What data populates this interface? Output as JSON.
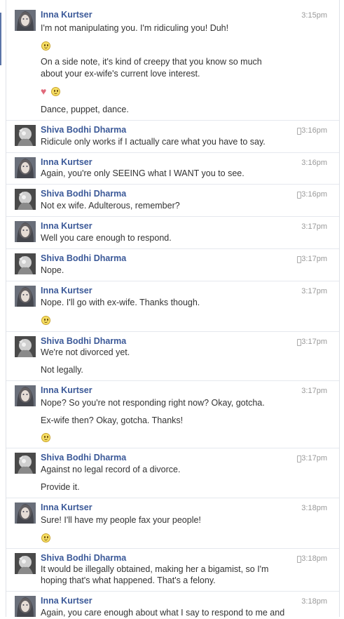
{
  "colors": {
    "sender_name": "#3b5998",
    "timestamp": "#999999",
    "message_text": "#333333",
    "divider": "#e5e8ee"
  },
  "icons": {
    "emoticon": "smiley-icon",
    "heart": "heart-icon",
    "mobile": "mobile-phone-icon"
  },
  "messages": [
    {
      "sender": "Inna Kurtser",
      "time": "3:15pm",
      "lines": [
        "I'm not manipulating you. I'm ridiculing you! Duh!",
        "On a side note, it's kind of creepy that you know so much",
        "about your ex-wife's current love interest.",
        "Dance, puppet, dance."
      ]
    },
    {
      "sender": "Shiva Bodhi Dharma",
      "time": "3:16pm",
      "lines": [
        "Ridicule only works if I actually care what you have to say."
      ]
    },
    {
      "sender": "Inna Kurtser",
      "time": "3:16pm",
      "lines": [
        "Again, you're only SEEING what I WANT you to see."
      ]
    },
    {
      "sender": "Shiva Bodhi Dharma",
      "time": "3:16pm",
      "lines": [
        "Not ex wife. Adulterous, remember?"
      ]
    },
    {
      "sender": "Inna Kurtser",
      "time": "3:17pm",
      "lines": [
        "Well you care enough to respond."
      ]
    },
    {
      "sender": "Shiva Bodhi Dharma",
      "time": "3:17pm",
      "lines": [
        "Nope."
      ]
    },
    {
      "sender": "Inna Kurtser",
      "time": "3:17pm",
      "lines": [
        "Nope. I'll go with ex-wife. Thanks though."
      ]
    },
    {
      "sender": "Shiva Bodhi Dharma",
      "time": "3:17pm",
      "lines": [
        "We're not divorced yet.",
        "Not legally."
      ]
    },
    {
      "sender": "Inna Kurtser",
      "time": "3:17pm",
      "lines": [
        "Nope? So you're not responding right now? Okay, gotcha.",
        "Ex-wife then? Okay, gotcha. Thanks!"
      ]
    },
    {
      "sender": "Shiva Bodhi Dharma",
      "time": "3:17pm",
      "lines": [
        "Against no legal record of a divorce.",
        "Provide it."
      ]
    },
    {
      "sender": "Inna Kurtser",
      "time": "3:18pm",
      "lines": [
        "Sure! I'll have my people fax your people!"
      ]
    },
    {
      "sender": "Shiva Bodhi Dharma",
      "time": "3:18pm",
      "lines": [
        "It would be illegally obtained, making her a bigamist, so I'm",
        "hoping that's what happened. That's a felony."
      ]
    },
    {
      "sender": "Inna Kurtser",
      "time": "3:18pm",
      "lines": [
        "Again, you care enough about what I say to respond to me and"
      ]
    }
  ]
}
